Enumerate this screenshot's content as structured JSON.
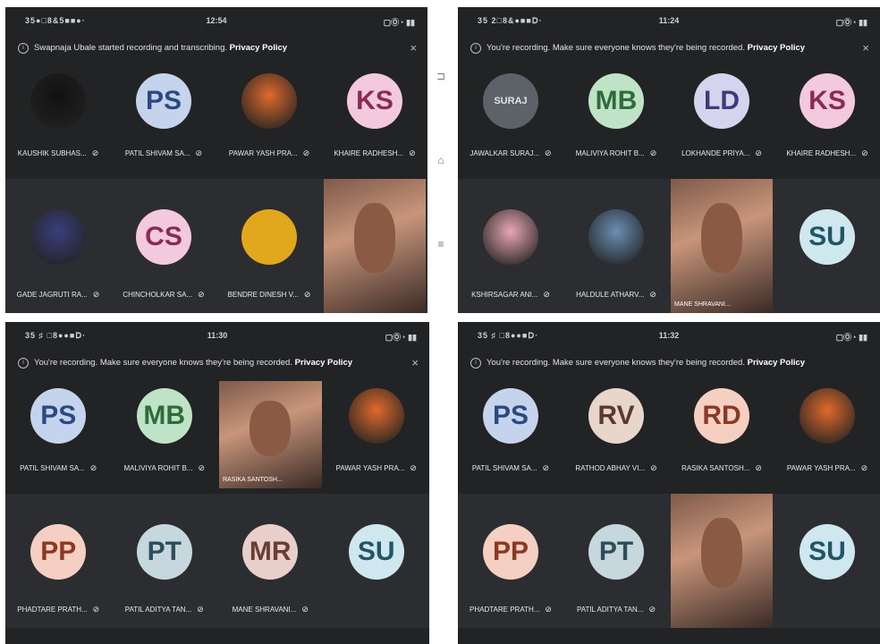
{
  "panels": [
    {
      "status": {
        "left": "35●□8&5■■●·",
        "time": "12:54",
        "right": "▢Ⓞ◔ ▮▮"
      },
      "banner": {
        "msg": "Swapnaja Ubale started recording and transcribing.",
        "link": "Privacy Policy",
        "close": "×"
      },
      "row1": [
        {
          "name": "KAUSHIK SUBHAS...",
          "kind": "photo",
          "color": "#111111"
        },
        {
          "initials": "PS",
          "name": "PATIL SHIVAM SA...",
          "bg": "#c5d4ec",
          "fg": "#2b4a80"
        },
        {
          "name": "PAWAR YASH PRA...",
          "kind": "photo",
          "color": "#e06a2c"
        },
        {
          "initials": "KS",
          "name": "KHAIRE RADHESH...",
          "bg": "#f3c9dd",
          "fg": "#8a2a56"
        }
      ],
      "row2": [
        {
          "name": "GADE JAGRUTI RA...",
          "kind": "photo",
          "color": "#3a3f7a"
        },
        {
          "initials": "CS",
          "name": "CHINCHOLKAR SA...",
          "bg": "#f3c9dd",
          "fg": "#8a2a56"
        },
        {
          "initials": "",
          "name": "BENDRE DINESH V...",
          "bg": "#e2a81d",
          "fg": "#7a5500"
        },
        {
          "name": "",
          "kind": "video"
        }
      ]
    },
    {
      "status": {
        "left": "35 2□8&●■■Ⅾ·",
        "time": "11:24",
        "right": "▢Ⓞ◔ ▮▮"
      },
      "banner": {
        "msg": "You're recording. Make sure everyone knows they're being recorded.",
        "link": "Privacy Policy",
        "close": "×"
      },
      "row1": [
        {
          "initials": "SURAJ",
          "name": "JAWALKAR SURAJ...",
          "bg": "#5d6268",
          "fg": "#dfe3e8"
        },
        {
          "initials": "MB",
          "name": "MALIVIYA ROHIT B...",
          "bg": "#bfe3c6",
          "fg": "#2f6b3b"
        },
        {
          "initials": "LD",
          "name": "LOKHANDE PRIYA...",
          "bg": "#d5d3ee",
          "fg": "#3f3a7a"
        },
        {
          "initials": "KS",
          "name": "KHAIRE RADHESH...",
          "bg": "#f3c9dd",
          "fg": "#8a2a56"
        }
      ],
      "row2": [
        {
          "name": "KSHIRSAGAR ANI...",
          "kind": "photo",
          "color": "#e9a7b2"
        },
        {
          "name": "HALDULE ATHARV...",
          "kind": "photo",
          "color": "#6b8fb3"
        },
        {
          "name": "MANE SHRAVANI...",
          "kind": "video"
        },
        {
          "initials": "SU",
          "name": "",
          "bg": "#cfe7ee",
          "fg": "#225566"
        }
      ]
    },
    {
      "status": {
        "left": "35 ♯ □8●●■Ⅾ·",
        "time": "11:30",
        "right": "▢Ⓞ◔ ▮▮"
      },
      "banner": {
        "msg": "You're recording. Make sure everyone knows they're being recorded.",
        "link": "Privacy Policy",
        "close": "×"
      },
      "row1": [
        {
          "initials": "PS",
          "name": "PATIL SHIVAM SA...",
          "bg": "#c5d4ec",
          "fg": "#2b4a80"
        },
        {
          "initials": "MB",
          "name": "MALIVIYA ROHIT B...",
          "bg": "#bfe3c6",
          "fg": "#2f6b3b"
        },
        {
          "name": "RASIKA SANTOSH...",
          "kind": "video"
        },
        {
          "name": "PAWAR YASH PRA...",
          "kind": "photo",
          "color": "#e06a2c"
        }
      ],
      "row2": [
        {
          "initials": "PP",
          "name": "PHADTARE PRATH...",
          "bg": "#f6cfc3",
          "fg": "#8a3a22"
        },
        {
          "initials": "PT",
          "name": "PATIL ADITYA TAN...",
          "bg": "#c7d7de",
          "fg": "#2d4d5a"
        },
        {
          "initials": "MR",
          "name": "MANE SHRAVANI...",
          "bg": "#e8cfc9",
          "fg": "#6a3e34"
        },
        {
          "initials": "SU",
          "name": "",
          "bg": "#cfe7ee",
          "fg": "#225566"
        }
      ]
    },
    {
      "status": {
        "left": "35 ♯ □8●●■Ⅾ·",
        "time": "11:32",
        "right": "▢Ⓞ◔ ▮▮"
      },
      "banner": {
        "msg": "You're recording. Make sure everyone knows they're being recorded.",
        "link": "Privacy Policy",
        "close": ""
      },
      "row1": [
        {
          "initials": "PS",
          "name": "PATIL SHIVAM SA...",
          "bg": "#c5d4ec",
          "fg": "#2b4a80"
        },
        {
          "initials": "RV",
          "name": "RATHOD ABHAY VI...",
          "bg": "#e8d6cd",
          "fg": "#5b3a2c"
        },
        {
          "initials": "RD",
          "name": "RASIKA SANTOSH...",
          "bg": "#f6cfc3",
          "fg": "#8a3a22"
        },
        {
          "name": "PAWAR YASH PRA...",
          "kind": "photo",
          "color": "#e06a2c"
        }
      ],
      "row2": [
        {
          "initials": "PP",
          "name": "PHADTARE PRATH...",
          "bg": "#f6cfc3",
          "fg": "#8a3a22"
        },
        {
          "initials": "PT",
          "name": "PATIL ADITYA TAN...",
          "bg": "#c7d7de",
          "fg": "#2d4d5a"
        },
        {
          "name": "",
          "kind": "video"
        },
        {
          "initials": "SU",
          "name": "",
          "bg": "#cfe7ee",
          "fg": "#225566"
        }
      ]
    }
  ],
  "nav": {
    "back": "⊐",
    "home": "⌂",
    "menu": "≡"
  }
}
